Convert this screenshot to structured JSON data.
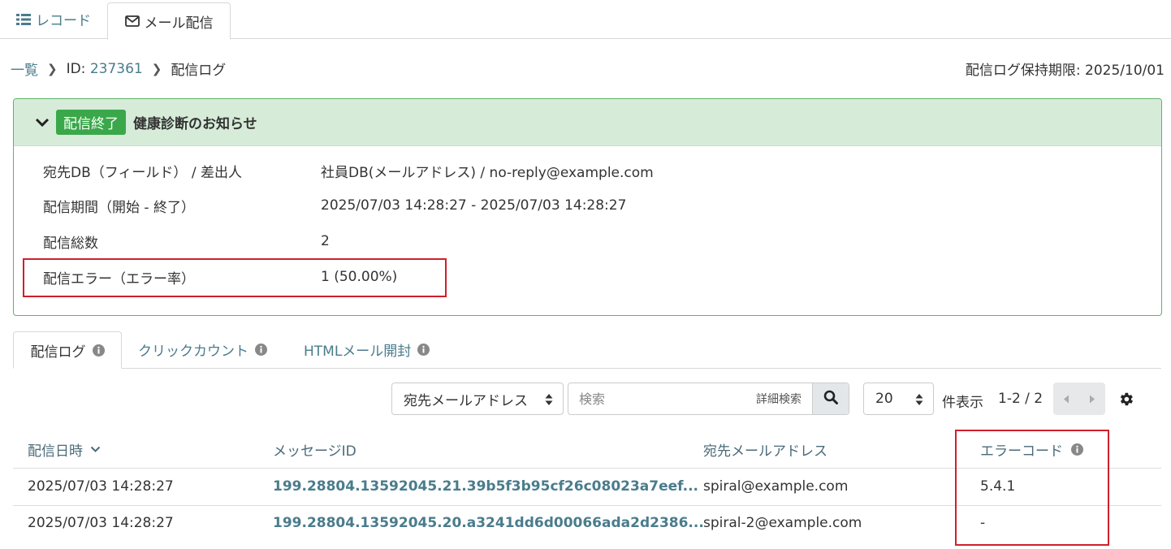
{
  "top_tabs": {
    "records": "レコード",
    "mail": "メール配信"
  },
  "breadcrumb": {
    "list": "一覧",
    "id_label": "ID:",
    "id_value": "237361",
    "current": "配信ログ"
  },
  "retention": "配信ログ保持期限: 2025/10/01",
  "panel": {
    "status_badge": "配信終了",
    "title": "健康診断のお知らせ",
    "rows": [
      {
        "label": "宛先DB（フィールド） / 差出人",
        "value": "社員DB(メールアドレス) / no-reply@example.com"
      },
      {
        "label": "配信期間（開始 - 終了）",
        "value": "2025/07/03 14:28:27 - 2025/07/03 14:28:27"
      },
      {
        "label": "配信総数",
        "value": "2"
      },
      {
        "label": "配信エラー（エラー率）",
        "value": "1 (50.00%)"
      }
    ]
  },
  "sub_tabs": [
    {
      "label": "配信ログ",
      "active": true
    },
    {
      "label": "クリックカウント",
      "active": false
    },
    {
      "label": "HTMLメール開封",
      "active": false
    }
  ],
  "toolbar": {
    "field_select": "宛先メールアドレス",
    "search_placeholder": "検索",
    "advanced_search": "詳細検索",
    "per_page": "20",
    "per_page_label": "件表示",
    "range": "1-2 / 2"
  },
  "table": {
    "headers": [
      "配信日時",
      "メッセージID",
      "宛先メールアドレス",
      "エラーコード"
    ],
    "rows": [
      {
        "datetime": "2025/07/03 14:28:27",
        "message_id": "199.28804.13592045.21.39b5f3b95cf26c08023a7eef...",
        "email": "spiral@example.com",
        "error_code": "5.4.1"
      },
      {
        "datetime": "2025/07/03 14:28:27",
        "message_id": "199.28804.13592045.20.a3241dd6d00066ada2d2386...",
        "email": "spiral-2@example.com",
        "error_code": "-"
      }
    ]
  },
  "colors": {
    "accent": "#4a7c8c",
    "success": "#3aa84a",
    "panel_header_bg": "#d6ecd9",
    "highlight": "#d0202c"
  }
}
